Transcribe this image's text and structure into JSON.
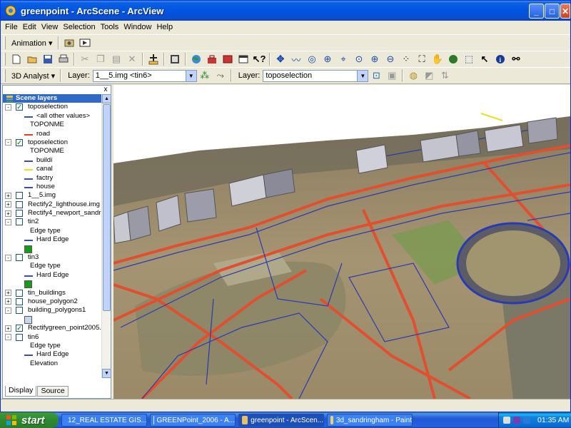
{
  "window": {
    "title": "greenpoint - ArcScene - ArcView",
    "buttons": {
      "minimize": "_",
      "maximize": "□",
      "close": "✕"
    }
  },
  "menu": [
    "File",
    "Edit",
    "View",
    "Selection",
    "Tools",
    "Window",
    "Help"
  ],
  "animation_toolbar": {
    "label": "Animation ▾"
  },
  "standard_toolbar": {
    "icons": [
      "new-icon",
      "open-icon",
      "save-icon",
      "print-icon",
      "cut-icon",
      "copy-icon",
      "paste-icon",
      "delete-icon",
      "add-data-icon",
      "scene-properties-icon",
      "globe-icon",
      "arctoolbox-icon",
      "python-icon",
      "window-icon",
      "whats-this-icon",
      "navigate-icon",
      "fly-icon",
      "target-center-icon",
      "zoom-to-target-icon",
      "observer-icon",
      "zoom-in-out-icon",
      "zoom-in-icon",
      "zoom-out-icon",
      "pan-icon",
      "full-extent-icon",
      "narrow-fov-icon",
      "select-icon",
      "identify-icon",
      "find-icon"
    ]
  },
  "analyst_toolbar": {
    "label": "3D Analyst ▾",
    "layer_label": "Layer:",
    "layer_value": "1__5.img <tin6>",
    "layer2_label": "Layer:",
    "layer2_value": "toposelection"
  },
  "toc": {
    "header": "Scene layers",
    "close": "x",
    "rows": [
      {
        "expander": "-",
        "checkbox": "✓",
        "text": "toposelection",
        "indent": 1
      },
      {
        "symbol": "line",
        "color": "#3a4fa8",
        "text": "<all other values>",
        "indent": 2
      },
      {
        "text": "TOPONME",
        "indent": 2
      },
      {
        "symbol": "line",
        "color": "#e04020",
        "text": "road",
        "indent": 2
      },
      {
        "expander": "-",
        "checkbox": "✓",
        "text": "toposelection",
        "indent": 1
      },
      {
        "text": "TOPONME",
        "indent": 2
      },
      {
        "symbol": "line",
        "color": "#3a4fa8",
        "text": "buildi",
        "indent": 2
      },
      {
        "symbol": "line",
        "color": "#e8e020",
        "text": "canal",
        "indent": 2
      },
      {
        "symbol": "line",
        "color": "#3a4fa8",
        "text": "factry",
        "indent": 2
      },
      {
        "symbol": "line",
        "color": "#3a4fa8",
        "text": "house",
        "indent": 2
      },
      {
        "expander": "+",
        "checkbox": "",
        "text": "1__5.img",
        "indent": 1
      },
      {
        "expander": "+",
        "checkbox": "",
        "text": "Rectify2_lighthouse.img",
        "indent": 1
      },
      {
        "expander": "+",
        "checkbox": "",
        "text": "Rectify4_newport_sandrin",
        "indent": 1
      },
      {
        "expander": "-",
        "checkbox": "",
        "text": "tin2",
        "indent": 1
      },
      {
        "text": "Edge type",
        "indent": 2
      },
      {
        "symbol": "line",
        "color": "#3a4fa8",
        "text": "Hard Edge",
        "indent": 2
      },
      {
        "symbol": "box",
        "color": "#1a9a1a",
        "text": "",
        "indent": 2
      },
      {
        "expander": "-",
        "checkbox": "",
        "text": "tin3",
        "indent": 1
      },
      {
        "text": "Edge type",
        "indent": 2
      },
      {
        "symbol": "line",
        "color": "#3a4fa8",
        "text": "Hard Edge",
        "indent": 2
      },
      {
        "symbol": "box",
        "color": "#1a9a1a",
        "text": "",
        "indent": 2
      },
      {
        "expander": "+",
        "checkbox": "",
        "text": "tin_buildings",
        "indent": 1
      },
      {
        "expander": "+",
        "checkbox": "",
        "text": "house_polygon2",
        "indent": 1
      },
      {
        "expander": "-",
        "checkbox": "",
        "text": "building_polygons1",
        "indent": 1
      },
      {
        "symbol": "box",
        "color": "#c6d8f0",
        "text": "",
        "indent": 2
      },
      {
        "expander": "+",
        "checkbox": "✓",
        "text": "Rectifygreen_point2005.im",
        "indent": 1
      },
      {
        "expander": "-",
        "checkbox": "",
        "text": "tin6",
        "indent": 1
      },
      {
        "text": "Edge type",
        "indent": 2
      },
      {
        "symbol": "line",
        "color": "#3a4fa8",
        "text": "Hard Edge",
        "indent": 2
      },
      {
        "text": "Elevation",
        "indent": 2
      }
    ],
    "tabs": [
      "Display",
      "Source"
    ]
  },
  "taskbar": {
    "start": "start",
    "tasks": [
      {
        "label": "12_REAL ESTATE GIS...",
        "color": "#e8c060"
      },
      {
        "label": "GREENPoint_2006 - A...",
        "color": "#f0f0f0"
      },
      {
        "label": "greenpoint - ArcScen...",
        "color": "#e8c060"
      },
      {
        "label": "3d_sandringham - Paint",
        "color": "#f0d060"
      }
    ],
    "clock": "01:35 AM"
  },
  "scene": {
    "description_colors": {
      "sky": "#ffffff",
      "ground": "#9a8a68",
      "roads": "#e05030",
      "boundaries": "#2a3ab0"
    }
  }
}
